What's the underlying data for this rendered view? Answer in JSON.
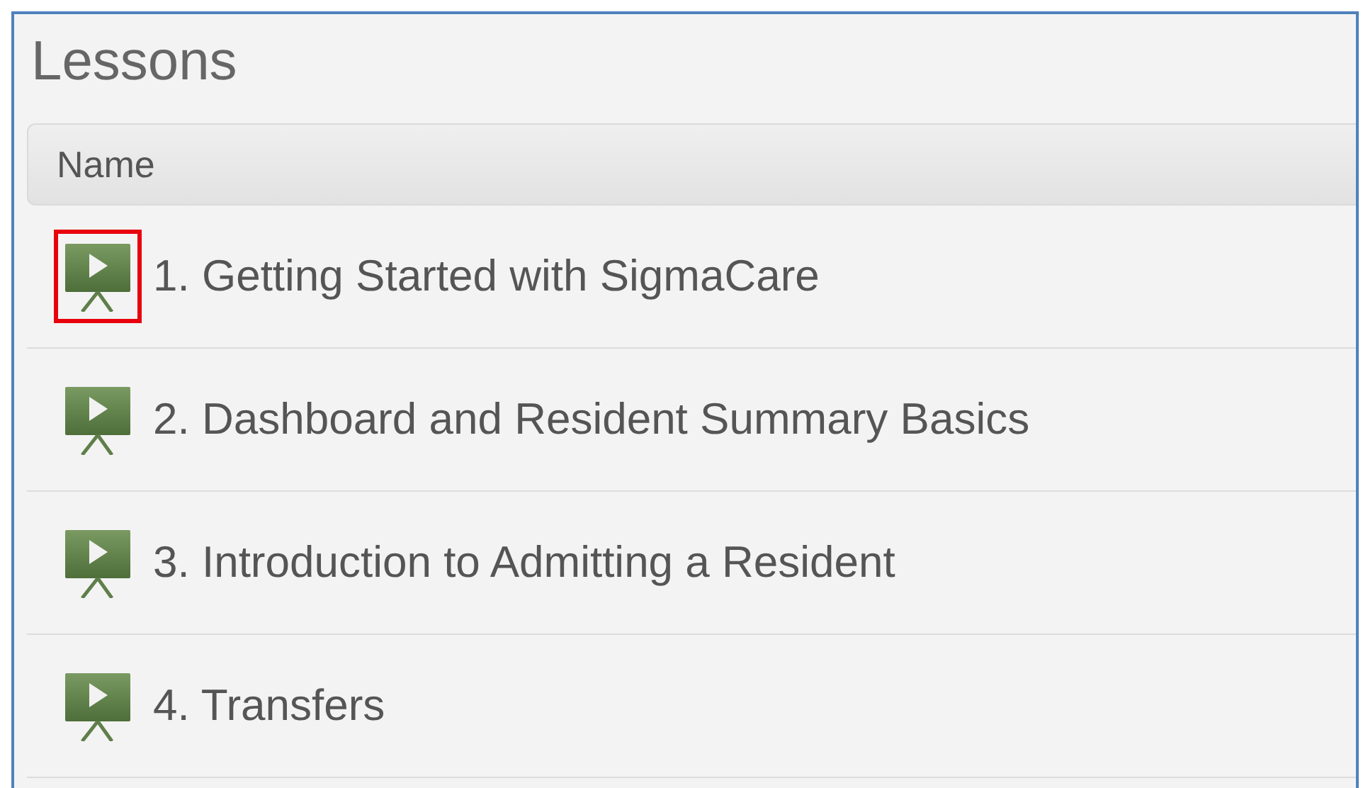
{
  "title": "Lessons",
  "table": {
    "columns": [
      "Name"
    ],
    "rows": [
      {
        "name": "1. Getting Started with SigmaCare",
        "highlighted": true
      },
      {
        "name": "2. Dashboard and Resident Summary Basics",
        "highlighted": false
      },
      {
        "name": "3. Introduction to Admitting a Resident",
        "highlighted": false
      },
      {
        "name": "4. Transfers",
        "highlighted": false
      }
    ]
  }
}
